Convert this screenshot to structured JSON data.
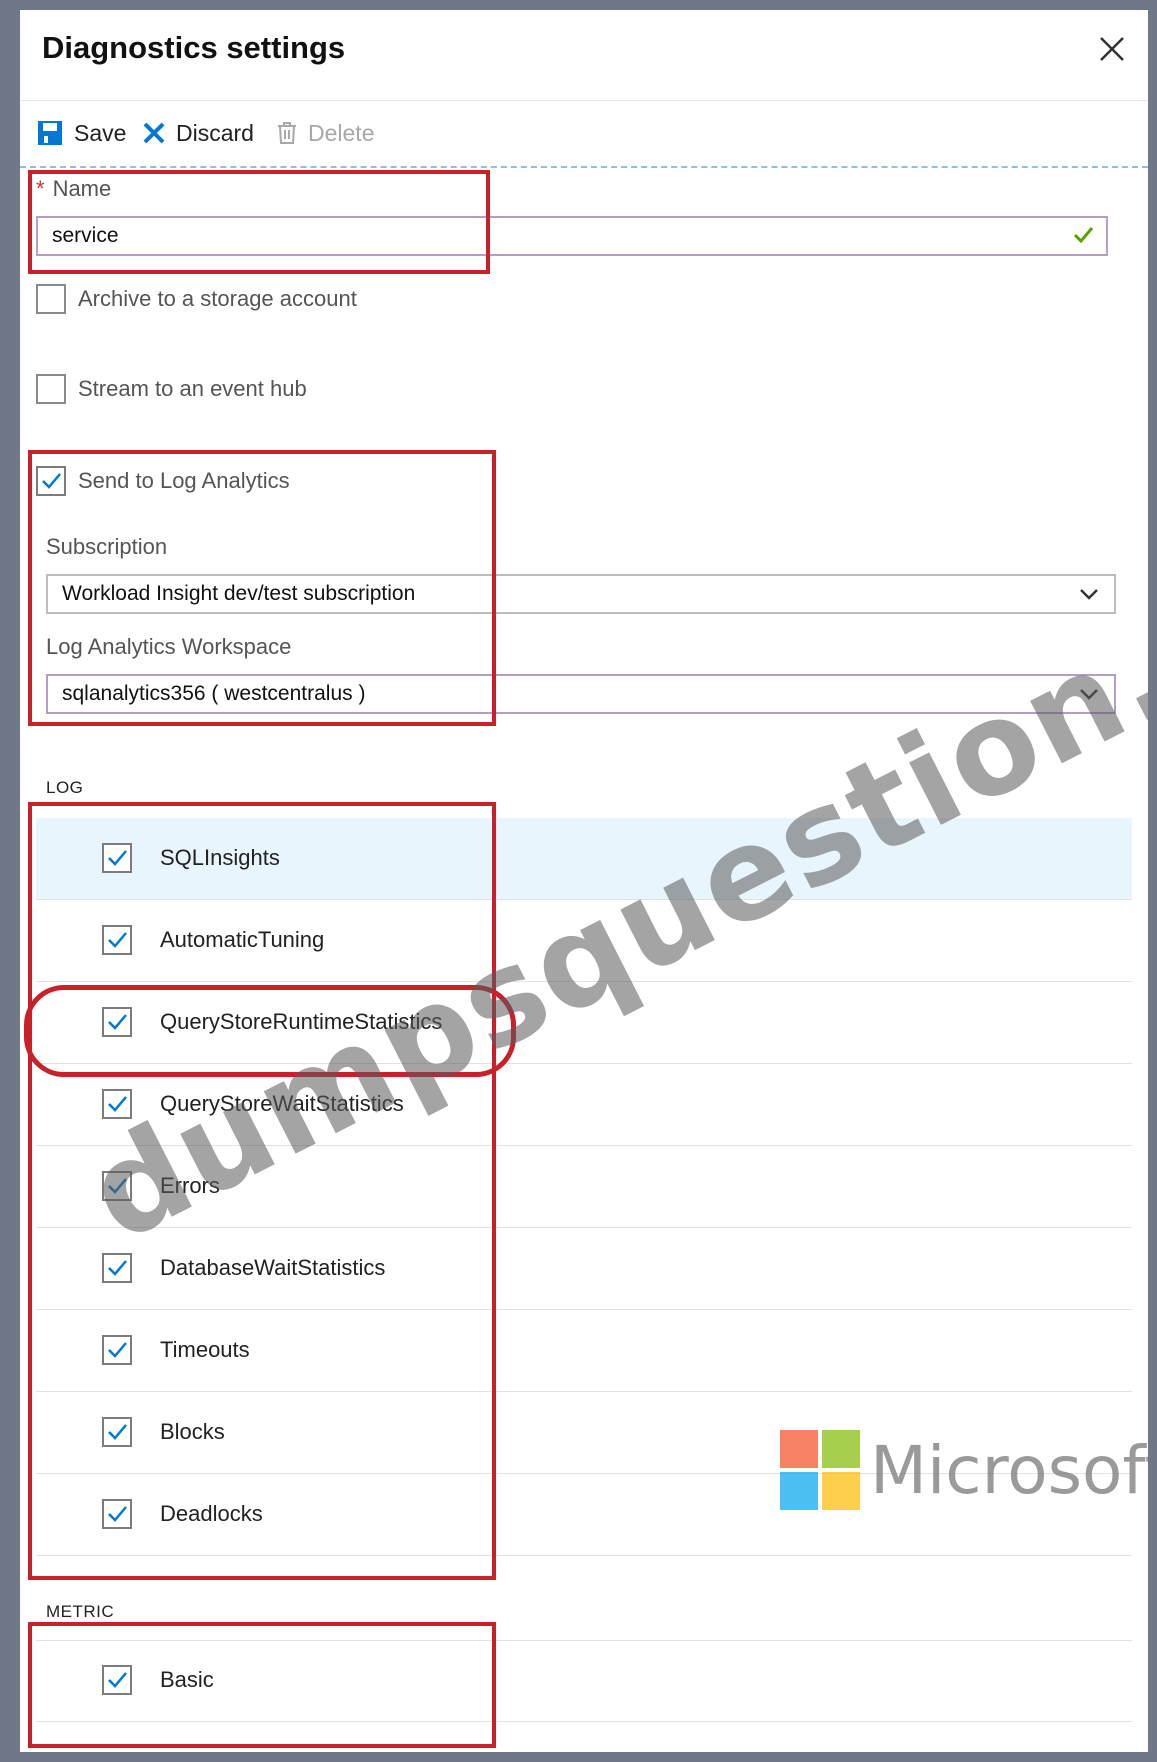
{
  "panel": {
    "title": "Diagnostics settings"
  },
  "toolbar": {
    "save_label": "Save",
    "discard_label": "Discard",
    "delete_label": "Delete"
  },
  "name_field": {
    "label": "Name",
    "required_mark": "*",
    "value": "service"
  },
  "destinations": {
    "archive_label": "Archive to a storage account",
    "archive_checked": false,
    "eventhub_label": "Stream to an event hub",
    "eventhub_checked": false,
    "loganalytics_label": "Send to Log Analytics",
    "loganalytics_checked": true
  },
  "subscription": {
    "label": "Subscription",
    "value": "Workload Insight dev/test subscription"
  },
  "workspace": {
    "label": "Log Analytics Workspace",
    "value": "sqlanalytics356 ( westcentralus )"
  },
  "log_section": {
    "header": "LOG",
    "items": [
      {
        "label": "SQLInsights",
        "checked": true
      },
      {
        "label": "AutomaticTuning",
        "checked": true
      },
      {
        "label": "QueryStoreRuntimeStatistics",
        "checked": true
      },
      {
        "label": "QueryStoreWaitStatistics",
        "checked": true
      },
      {
        "label": "Errors",
        "checked": true
      },
      {
        "label": "DatabaseWaitStatistics",
        "checked": true
      },
      {
        "label": "Timeouts",
        "checked": true
      },
      {
        "label": "Blocks",
        "checked": true
      },
      {
        "label": "Deadlocks",
        "checked": true
      }
    ]
  },
  "metric_section": {
    "header": "METRIC",
    "items": [
      {
        "label": "Basic",
        "checked": true
      }
    ]
  },
  "watermark": {
    "text": "dumpsquestion.com",
    "brand": "Microsoft"
  },
  "colors": {
    "accent": "#0078d4",
    "annotation": "#c9202a",
    "highlight_row": "#e9f5fc",
    "valid": "#57a300"
  }
}
